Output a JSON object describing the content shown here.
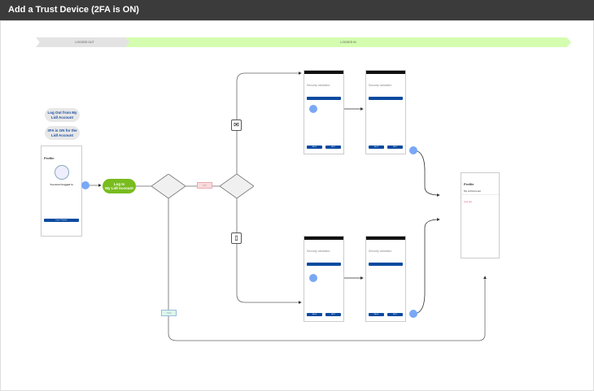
{
  "header": {
    "title": "Add a Trust Device  (2FA is ON)"
  },
  "bands": {
    "logged_out": "LOGGED OUT",
    "logged_in": "LOGGED IN"
  },
  "notes": [
    "Log Out from My Lidl Account",
    "2FA is ON for the Lidl Account"
  ],
  "start_phone": {
    "title": "Profile",
    "heading": "You aren't logged in",
    "button": "Log in / Register"
  },
  "login_button": "Log In\nMy Lidl Account",
  "decisions": {
    "first": "",
    "second": "",
    "no_label": "NO",
    "yes_label": "YES"
  },
  "channels": {
    "email_icon": "mail-icon",
    "sms_icon": "mobile-phone-icon"
  },
  "validation_screens": {
    "title": "Security validation",
    "send": "Send code",
    "back": "BACK",
    "next": "NEXT"
  },
  "end_phone": {
    "title": "Profile",
    "item": "My Lidl Account",
    "logout": "Log out"
  },
  "colors": {
    "header": "#3b3b3b",
    "logged_in_band": "#d4fdb0",
    "login": "#78bc1e",
    "hotspot": "#7aa8f5"
  }
}
